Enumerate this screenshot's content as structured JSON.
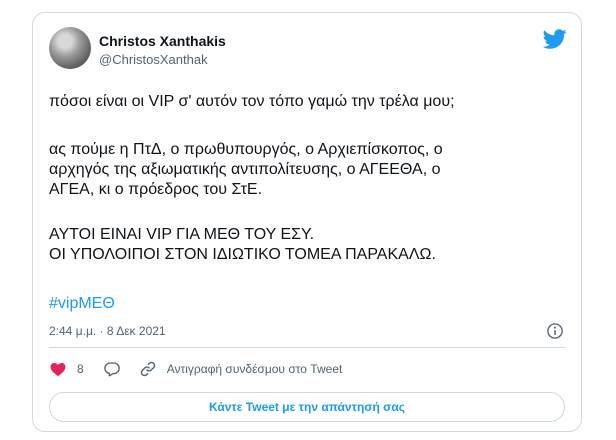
{
  "tweet": {
    "author_name": "Christos Xanthakis",
    "author_handle": "@ChristosXanthak",
    "lines": [
      "πόσοι είναι οι VIP σ' αυτόν τον τόπο γαμώ την τρέλα μου;",
      "ας πούμε η ΠτΔ, ο πρωθυπουργός, ο Αρχιεπίσκοπος, ο",
      "αρχηγός της αξιωματικής αντιπολίτευσης, ο ΑΓΕΕΘΑ, ο",
      "ΑΓΕΑ, κι ο πρόεδρος του ΣτΕ.",
      "ΑΥΤΟΙ ΕΙΝΑΙ VIP ΓΙΑ ΜΕΘ ΤΟΥ ΕΣΥ.",
      "ΟΙ ΥΠΟΛΟΙΠΟΙ ΣΤΟΝ ΙΔΙΩΤΙΚΟ ΤΟΜΕΑ ΠΑΡΑΚΑΛΩ."
    ],
    "hashtag": "#vipΜΕΘ",
    "timestamp": "2:44 μ.μ. · 8 Δεκ 2021"
  },
  "actions": {
    "like_count": "8",
    "copy_link_label": "Αντιγραφή συνδέσμου στο Tweet"
  },
  "cta": {
    "reply_label": "Κάντε Tweet με την απάντησή σας"
  },
  "icons": {
    "brand": "twitter-bird-icon",
    "like": "heart-icon",
    "reply": "speech-bubble-icon",
    "copy": "link-icon",
    "info": "info-icon"
  },
  "colors": {
    "accent": "#1d9bf0",
    "like": "#e0245e",
    "text": "#0f1419",
    "muted": "#536471",
    "border": "#cfd9de"
  }
}
